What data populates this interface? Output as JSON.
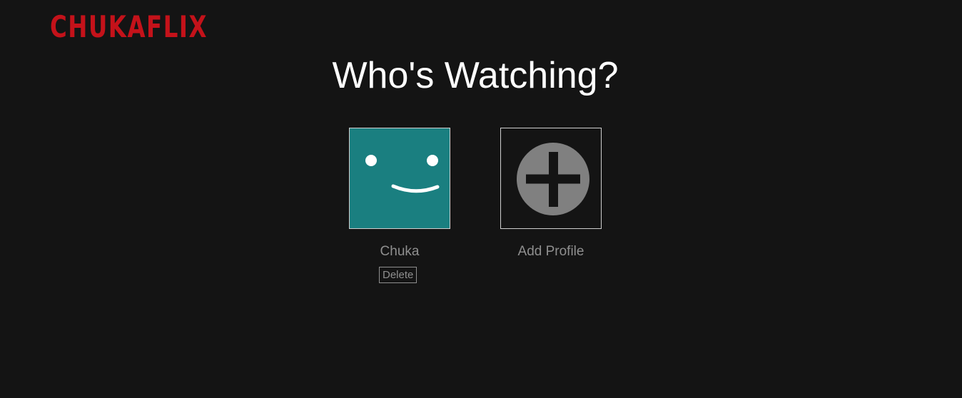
{
  "header": {
    "logo_text": "CHUKAFLIX",
    "logo_color": "#c4121a"
  },
  "main": {
    "title": "Who's Watching?",
    "profiles": [
      {
        "name": "Chuka",
        "avatar_icon": "smiley-face-icon",
        "avatar_color": "#1a7f80",
        "delete_label": "Delete"
      }
    ],
    "add_profile": {
      "label": "Add Profile",
      "icon": "plus-circle-icon"
    }
  },
  "colors": {
    "background": "#141414",
    "text_primary": "#ffffff",
    "text_muted": "#8f8f8f"
  }
}
